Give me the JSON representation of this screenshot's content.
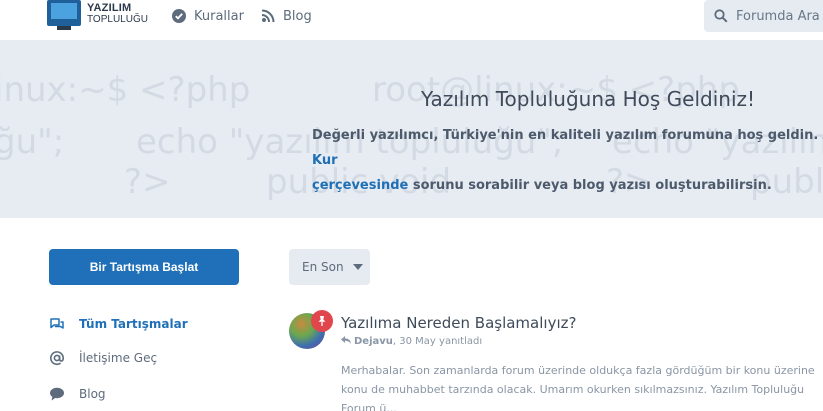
{
  "logo": {
    "line1": "YAZILIM",
    "line2": "TOPLULUĞU"
  },
  "nav": {
    "rules_label": "Kurallar",
    "blog_label": "Blog"
  },
  "search": {
    "placeholder": "Forumda Ara"
  },
  "hero": {
    "title": "Yazılım Topluluğuna Hoş Geldiniz!",
    "desc_part1": "Değerli yazılımcı, Türkiye'nin en kaliteli yazılım forumuna hoş geldin. ",
    "desc_link1": "Kur",
    "desc_link2": "çerçevesinde",
    "desc_part2": " sorunu sorabilir veya blog yazısı oluşturabilirsin.",
    "bg_code": [
      "inux:~$ <?php",
      "root@linux:~$ <?php",
      "ğu\";",
      "echo \"yazılım topluluğu\";",
      "echo \"yazılım",
      "?>",
      "public void",
      "?>",
      "publi"
    ]
  },
  "sidebar": {
    "start_button": "Bir Tartışma Başlat",
    "items": [
      {
        "label": "Tüm Tartışmalar",
        "icon": "comments-icon"
      },
      {
        "label": "İletişime Geç",
        "icon": "at-icon"
      },
      {
        "label": "Blog",
        "icon": "comment-icon"
      }
    ]
  },
  "main": {
    "sort_label": "En Son",
    "discussion": {
      "title": "Yazılıma Nereden Başlamalıyız?",
      "author": "Dejavu",
      "meta_suffix": ", 30 May yanıtladı",
      "excerpt": "Merhabalar. Son zamanlarda forum üzerinde oldukça fazla gördüğüm bir konu üzerine konu de muhabbet tarzında olacak. Umarım okurken sıkılmazsınız. Yazılım Topluluğu Forum ü..."
    }
  },
  "colors": {
    "accent": "#1f70b8",
    "hero_bg": "#e7ecf3",
    "pin": "#e0464b"
  }
}
